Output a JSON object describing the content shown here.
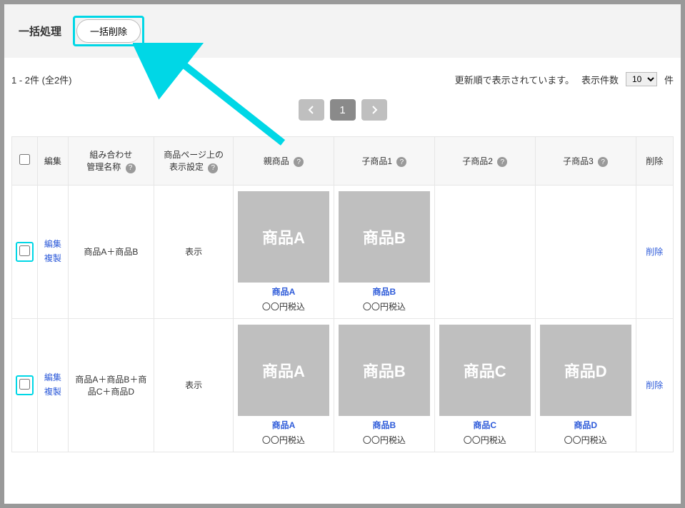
{
  "bulk": {
    "title": "一括処理",
    "delete_label": "一括削除"
  },
  "info": {
    "count_text": "1 - 2件 (全2件)",
    "sort_text": "更新順で表示されています。",
    "page_size_label": "表示件数",
    "page_size_value": "10",
    "unit": "件"
  },
  "pagination": {
    "prev": "<",
    "current": "1",
    "next": ">"
  },
  "headers": {
    "edit": "編集",
    "combo_name": "組み合わせ\n管理名称",
    "display": "商品ページ上の\n表示設定",
    "parent": "親商品",
    "child1": "子商品1",
    "child2": "子商品2",
    "child3": "子商品3",
    "delete": "削除"
  },
  "links": {
    "edit": "編集",
    "copy": "複製",
    "delete": "削除"
  },
  "rows": [
    {
      "name": "商品A＋商品B",
      "display": "表示",
      "products": [
        {
          "img_label": "商品A",
          "name": "商品A",
          "price": "〇〇円税込"
        },
        {
          "img_label": "商品B",
          "name": "商品B",
          "price": "〇〇円税込"
        },
        null,
        null
      ]
    },
    {
      "name": "商品A＋商品B＋商品C＋商品D",
      "display": "表示",
      "products": [
        {
          "img_label": "商品A",
          "name": "商品A",
          "price": "〇〇円税込"
        },
        {
          "img_label": "商品B",
          "name": "商品B",
          "price": "〇〇円税込"
        },
        {
          "img_label": "商品C",
          "name": "商品C",
          "price": "〇〇円税込"
        },
        {
          "img_label": "商品D",
          "name": "商品D",
          "price": "〇〇円税込"
        }
      ]
    }
  ]
}
